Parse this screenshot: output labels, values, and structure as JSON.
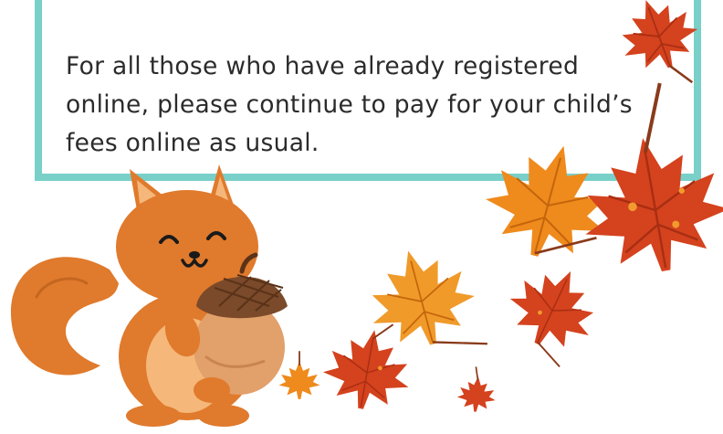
{
  "notice": {
    "text": "For all those who have already registered online, please continue to pay for your child’s fees online as usual."
  },
  "illustration": {
    "character": "squirrel-holding-acorn",
    "decoration": "autumn-maple-leaves"
  },
  "colors": {
    "border": "#78d0c9",
    "squirrel_fur": "#e07a2c",
    "squirrel_belly": "#f5b77a",
    "acorn_cap": "#7a4a2a",
    "acorn_nut": "#e2a06a",
    "leaf_red": "#d4421e",
    "leaf_orange": "#ef8a1c"
  }
}
